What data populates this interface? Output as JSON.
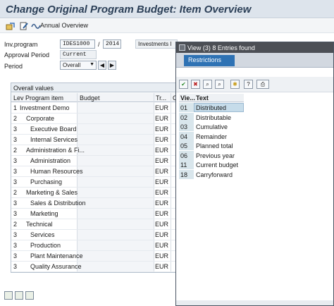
{
  "title": "Change Original Program Budget: Item Overview",
  "toolbar": {
    "annual_overview": "Annual Overview"
  },
  "header": {
    "inv_program_label": "Inv.program",
    "inv_program_value": "IDES1000",
    "separator": "/",
    "approval_year": "2014",
    "description": "Investments I",
    "approval_period_label": "Approval Period",
    "approval_period_value": "Current",
    "period_label": "Period",
    "period_value": "Overall"
  },
  "table": {
    "title": "Overall values",
    "columns": [
      "Lev Program item",
      "Budget",
      "Tr...",
      "Cu"
    ],
    "rows": [
      {
        "lev": "1",
        "item": "Investment Demo",
        "currency": "EUR"
      },
      {
        "lev": "2",
        "item": "Corporate",
        "currency": "EUR"
      },
      {
        "lev": "3",
        "item": "Executive Board",
        "currency": "EUR"
      },
      {
        "lev": "3",
        "item": "Internal Services",
        "currency": "EUR"
      },
      {
        "lev": "2",
        "item": "Administration & Fi...",
        "currency": "EUR"
      },
      {
        "lev": "3",
        "item": "Administration",
        "currency": "EUR"
      },
      {
        "lev": "3",
        "item": "Human Resources",
        "currency": "EUR"
      },
      {
        "lev": "3",
        "item": "Purchasing",
        "currency": "EUR"
      },
      {
        "lev": "2",
        "item": "Marketing & Sales",
        "currency": "EUR"
      },
      {
        "lev": "3",
        "item": "Sales & Distribution",
        "currency": "EUR"
      },
      {
        "lev": "3",
        "item": "Marketing",
        "currency": "EUR"
      },
      {
        "lev": "2",
        "item": "Technical",
        "currency": "EUR"
      },
      {
        "lev": "3",
        "item": "Services",
        "currency": "EUR"
      },
      {
        "lev": "3",
        "item": "Production",
        "currency": "EUR"
      },
      {
        "lev": "3",
        "item": "Plant Maintenance",
        "currency": "EUR"
      },
      {
        "lev": "3",
        "item": "Quality Assurance",
        "currency": "EUR"
      }
    ]
  },
  "popup": {
    "title": "View (3)   8 Entries found",
    "tab": "Restrictions",
    "list_header": {
      "code": "Vie...",
      "text": "Text"
    },
    "entries": [
      {
        "code": "01",
        "text": "Distributed",
        "selected": true
      },
      {
        "code": "02",
        "text": "Distributable"
      },
      {
        "code": "03",
        "text": "Cumulative"
      },
      {
        "code": "04",
        "text": "Remainder"
      },
      {
        "code": "05",
        "text": "Planned total"
      },
      {
        "code": "06",
        "text": "Previous year"
      },
      {
        "code": "11",
        "text": "Current budget"
      },
      {
        "code": "18",
        "text": "Carryforward"
      }
    ]
  },
  "colors": {
    "title_text": "#2b3f57",
    "popup_header": "#4c4f55",
    "tab_active": "#2e72b4",
    "selection": "#c6dcea"
  }
}
